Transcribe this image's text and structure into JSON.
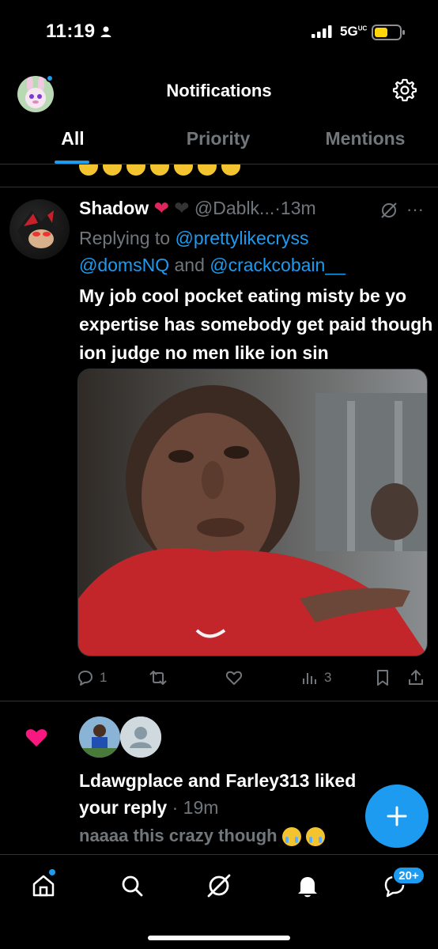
{
  "status_bar": {
    "time": "11:19",
    "network": "5G",
    "network_sup": "UC"
  },
  "header": {
    "title": "Notifications"
  },
  "tabs": [
    {
      "label": "All",
      "active": true
    },
    {
      "label": "Priority",
      "active": false
    },
    {
      "label": "Mentions",
      "active": false
    }
  ],
  "tweet": {
    "display_name": "Shadow",
    "name_emojis": [
      "red-heart",
      "black-heart"
    ],
    "handle": "@Dablk...",
    "time": "13m",
    "replying_to_prefix": "Replying to",
    "replying_to_1": "@prettylikecryss",
    "replying_to_2": "@domsNQ",
    "replying_and": "and",
    "replying_to_3": "@crackcobain__",
    "text": "My job cool pocket eating misty be yo expertise has somebody get paid though ion judge no men like ion sin",
    "replies": "1",
    "retweets": "",
    "likes": "",
    "views": "3"
  },
  "like_notification": {
    "text": "Ldawgplace and Farley313 liked your reply",
    "time": "19m",
    "preview": "naaaa this crazy though"
  },
  "bottom_nav": {
    "messages_badge": "20+"
  },
  "colors": {
    "accent": "#1d9bf0",
    "like_pink": "#f91880",
    "muted": "#71767b",
    "background": "#000000"
  }
}
